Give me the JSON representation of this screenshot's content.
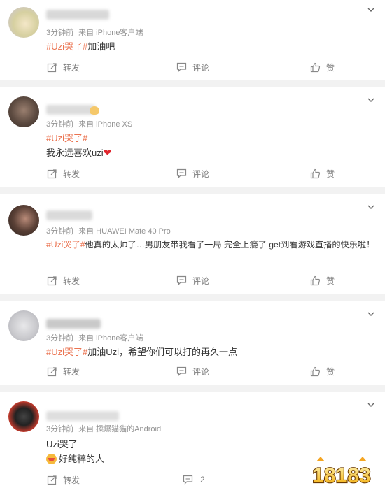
{
  "actions": {
    "forward": "转发",
    "comment": "评论",
    "like": "赞"
  },
  "posts": [
    {
      "meta_time": "3分钟前",
      "meta_source": "来自 iPhone客户端",
      "hashtag": "#Uzi哭了#",
      "text": "加油吧"
    },
    {
      "meta_time": "3分钟前",
      "meta_source": "来自 iPhone XS",
      "hashtag": "#Uzi哭了#",
      "text": "我永远喜欢uzi",
      "emoji": "❤"
    },
    {
      "meta_time": "3分钟前",
      "meta_source": "来自 HUAWEI Mate 40 Pro",
      "hashtag": "#Uzi哭了#",
      "text": "他真的太帅了…男朋友带我看了一局 完全上瘾了 get到看游戏直播的快乐啦！"
    },
    {
      "meta_time": "3分钟前",
      "meta_source": "来自 iPhone客户端",
      "hashtag": "#Uzi哭了#",
      "text": "加油Uzi，希望你们可以打的再久一点"
    },
    {
      "meta_time": "3分钟前",
      "meta_source": "来自 揉爆猫猫的Android",
      "text": "Uzi哭了",
      "text2": "好纯粹的人",
      "comment_count": "2"
    }
  ],
  "watermark": "18183",
  "colors": {
    "hashtag": "#eb7350",
    "heart": "#e0262e",
    "background": "#f2f2f2"
  }
}
